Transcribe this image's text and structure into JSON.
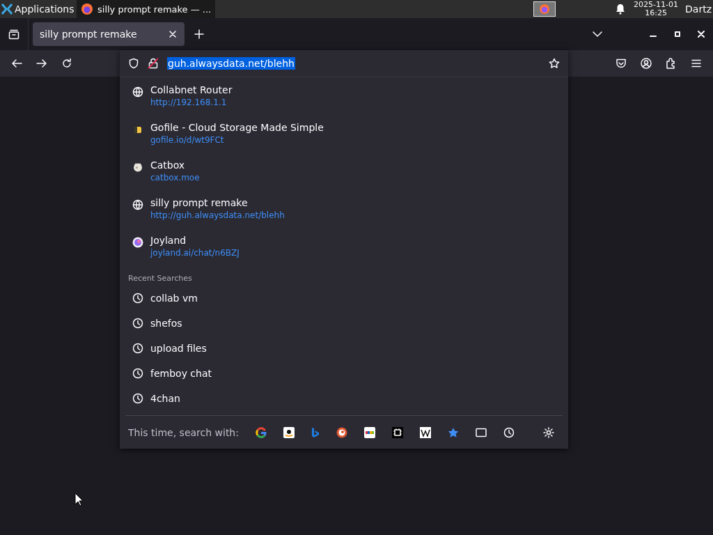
{
  "taskbar": {
    "apps_label": "Applications",
    "window_button": {
      "title": "silly prompt remake — ...",
      "selected": true
    },
    "clock_date": "2025-11-01",
    "clock_time": "16:25",
    "user": "Dartz"
  },
  "tabs": [
    {
      "title": "silly prompt remake",
      "selected": true
    }
  ],
  "address_bar": {
    "value": "guh.alwaysdata.net/blehh",
    "selected": true
  },
  "suggestions": [
    {
      "kind": "globe",
      "title": "Collabnet Router",
      "url": "http://192.168.1.1"
    },
    {
      "kind": "gofile",
      "title": "Gofile - Cloud Storage Made Simple",
      "url": "gofile.io/d/wt9FCt"
    },
    {
      "kind": "catbox",
      "title": "Catbox",
      "url": "catbox.moe"
    },
    {
      "kind": "globe",
      "title": "silly prompt remake",
      "url": "http://guh.alwaysdata.net/blehh"
    },
    {
      "kind": "joyland",
      "title": "Joyland",
      "url": "joyland.ai/chat/n6BZJ"
    }
  ],
  "recent_searches_heading": "Recent Searches",
  "recent_searches": [
    "collab vm",
    "shefos",
    "upload files",
    "femboy chat",
    "4chan"
  ],
  "search_with_label": "This time, search with:"
}
